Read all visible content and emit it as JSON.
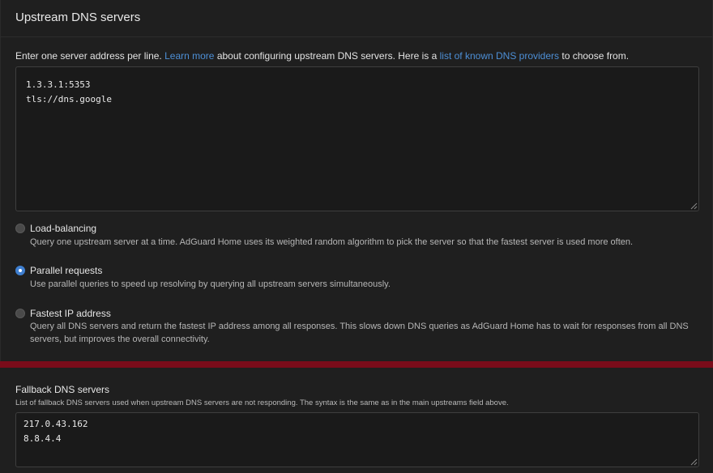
{
  "upstream": {
    "title": "Upstream DNS servers",
    "desc_prefix": "Enter one server address per line.",
    "learn_more": "Learn more",
    "desc_middle": "about configuring upstream DNS servers. Here is a",
    "providers_link": "list of known DNS providers",
    "desc_suffix": "to choose from.",
    "servers_text": "1.3.3.1:5353\ntls://dns.google"
  },
  "modes": [
    {
      "label": "Load-balancing",
      "description": "Query one upstream server at a time. AdGuard Home uses its weighted random algorithm to pick the server so that the fastest server is used more often.",
      "selected": false
    },
    {
      "label": "Parallel requests",
      "description": "Use parallel queries to speed up resolving by querying all upstream servers simultaneously.",
      "selected": true
    },
    {
      "label": "Fastest IP address",
      "description": "Query all DNS servers and return the fastest IP address among all responses. This slows down DNS queries as AdGuard Home has to wait for responses from all DNS servers, but improves the overall connectivity.",
      "selected": false
    }
  ],
  "fallback": {
    "title": "Fallback DNS servers",
    "description": "List of fallback DNS servers used when upstream DNS servers are not responding. The syntax is the same as in the main upstreams field above.",
    "servers_text": "217.0.43.162\n8.8.4.4"
  },
  "colors": {
    "accent": "#3f7fd0",
    "link": "#4d8fd6",
    "divider_red": "#7a0c1a",
    "background": "#1f1f1f"
  }
}
